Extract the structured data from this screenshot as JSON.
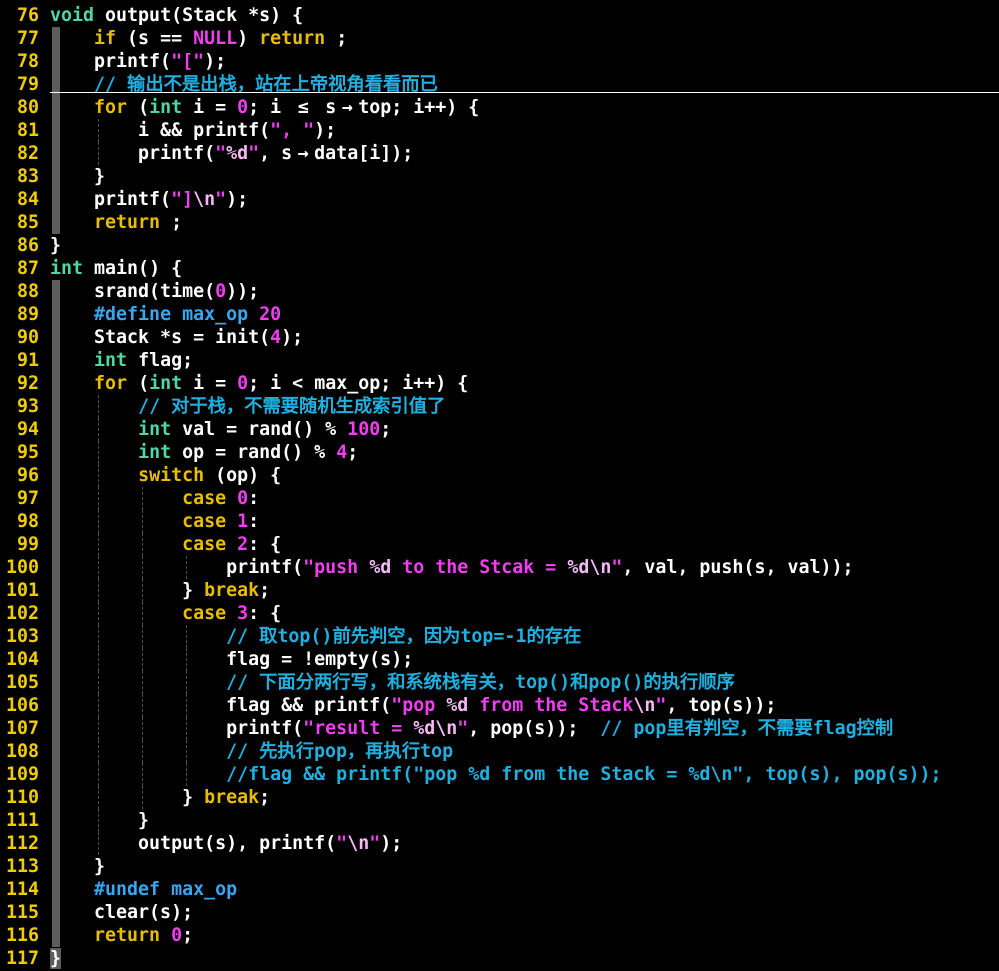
{
  "colors": {
    "background": "#000000",
    "text": "#ffffff",
    "line_number": "#efcc00",
    "keyword": "#e8bd00",
    "type": "#4fd6a8",
    "string": "#f03ef0",
    "escape": "#f4b8f4",
    "number": "#f03ef0",
    "comment": "#1fb0e0",
    "preprocessor": "#38a6f0",
    "indent_bar": "#5c5c5c",
    "indent_guide": "#4d4d4d",
    "cursor_line": "#ffffff"
  },
  "cursor_line": "79",
  "lines": [
    {
      "n": "76",
      "code": [
        [
          "ty",
          "void"
        ],
        [
          "pl",
          " output(Stack *s) {"
        ]
      ]
    },
    {
      "n": "77",
      "code": [
        [
          "pl",
          "    "
        ],
        [
          "kw",
          "if"
        ],
        [
          "pl",
          " (s == "
        ],
        [
          "const",
          "NULL"
        ],
        [
          "pl",
          ") "
        ],
        [
          "kw",
          "return"
        ],
        [
          "pl",
          " ;"
        ]
      ]
    },
    {
      "n": "78",
      "code": [
        [
          "pl",
          "    printf("
        ],
        [
          "str",
          "\"[\""
        ],
        [
          "pl",
          ");"
        ]
      ]
    },
    {
      "n": "79",
      "code": [
        [
          "pl",
          "    "
        ],
        [
          "cm",
          "// 输出不是出栈，站在上帝视角看看而已"
        ]
      ]
    },
    {
      "n": "80",
      "code": [
        [
          "pl",
          "    "
        ],
        [
          "kw",
          "for"
        ],
        [
          "pl",
          " ("
        ],
        [
          "ty",
          "int"
        ],
        [
          "pl",
          " i = "
        ],
        [
          "num",
          "0"
        ],
        [
          "pl",
          "; i "
        ],
        [
          "lig",
          "≤"
        ],
        [
          "pl",
          " s"
        ],
        [
          "lig",
          "→"
        ],
        [
          "pl",
          "top; i++) {"
        ]
      ]
    },
    {
      "n": "81",
      "code": [
        [
          "pl",
          "        i && printf("
        ],
        [
          "str",
          "\", \""
        ],
        [
          "pl",
          ");"
        ]
      ]
    },
    {
      "n": "82",
      "code": [
        [
          "pl",
          "        printf("
        ],
        [
          "str",
          "\""
        ],
        [
          "esc",
          "%d"
        ],
        [
          "str",
          "\""
        ],
        [
          "pl",
          ", s"
        ],
        [
          "lig",
          "→"
        ],
        [
          "pl",
          "data[i]);"
        ]
      ]
    },
    {
      "n": "83",
      "code": [
        [
          "pl",
          "    }"
        ]
      ]
    },
    {
      "n": "84",
      "code": [
        [
          "pl",
          "    printf("
        ],
        [
          "str",
          "\"]"
        ],
        [
          "esc",
          "\\n"
        ],
        [
          "str",
          "\""
        ],
        [
          "pl",
          ");"
        ]
      ]
    },
    {
      "n": "85",
      "code": [
        [
          "pl",
          "    "
        ],
        [
          "kw",
          "return"
        ],
        [
          "pl",
          " ;"
        ]
      ]
    },
    {
      "n": "86",
      "code": [
        [
          "pl",
          "}"
        ]
      ]
    },
    {
      "n": "87",
      "code": [
        [
          "ty",
          "int"
        ],
        [
          "pl",
          " main() {"
        ]
      ]
    },
    {
      "n": "88",
      "code": [
        [
          "pl",
          "    srand(time("
        ],
        [
          "num",
          "0"
        ],
        [
          "pl",
          "));"
        ]
      ]
    },
    {
      "n": "89",
      "code": [
        [
          "pl",
          "    "
        ],
        [
          "pp",
          "#define"
        ],
        [
          "pl",
          " "
        ],
        [
          "pp",
          "max_op"
        ],
        [
          "pl",
          " "
        ],
        [
          "num",
          "20"
        ]
      ]
    },
    {
      "n": "90",
      "code": [
        [
          "pl",
          "    Stack *s = init("
        ],
        [
          "num",
          "4"
        ],
        [
          "pl",
          ");"
        ]
      ]
    },
    {
      "n": "91",
      "code": [
        [
          "pl",
          "    "
        ],
        [
          "ty",
          "int"
        ],
        [
          "pl",
          " flag;"
        ]
      ]
    },
    {
      "n": "92",
      "code": [
        [
          "pl",
          "    "
        ],
        [
          "kw",
          "for"
        ],
        [
          "pl",
          " ("
        ],
        [
          "ty",
          "int"
        ],
        [
          "pl",
          " i = "
        ],
        [
          "num",
          "0"
        ],
        [
          "pl",
          "; i < max_op; i++) {"
        ]
      ]
    },
    {
      "n": "93",
      "code": [
        [
          "pl",
          "        "
        ],
        [
          "cm",
          "// 对于栈，不需要随机生成索引值了"
        ]
      ]
    },
    {
      "n": "94",
      "code": [
        [
          "pl",
          "        "
        ],
        [
          "ty",
          "int"
        ],
        [
          "pl",
          " val = rand() % "
        ],
        [
          "num",
          "100"
        ],
        [
          "pl",
          ";"
        ]
      ]
    },
    {
      "n": "95",
      "code": [
        [
          "pl",
          "        "
        ],
        [
          "ty",
          "int"
        ],
        [
          "pl",
          " op = rand() % "
        ],
        [
          "num",
          "4"
        ],
        [
          "pl",
          ";"
        ]
      ]
    },
    {
      "n": "96",
      "code": [
        [
          "pl",
          "        "
        ],
        [
          "kw",
          "switch"
        ],
        [
          "pl",
          " (op) {"
        ]
      ]
    },
    {
      "n": "97",
      "code": [
        [
          "pl",
          "            "
        ],
        [
          "kw",
          "case"
        ],
        [
          "pl",
          " "
        ],
        [
          "num",
          "0"
        ],
        [
          "pl",
          ":"
        ]
      ]
    },
    {
      "n": "98",
      "code": [
        [
          "pl",
          "            "
        ],
        [
          "kw",
          "case"
        ],
        [
          "pl",
          " "
        ],
        [
          "num",
          "1"
        ],
        [
          "pl",
          ":"
        ]
      ]
    },
    {
      "n": "99",
      "code": [
        [
          "pl",
          "            "
        ],
        [
          "kw",
          "case"
        ],
        [
          "pl",
          " "
        ],
        [
          "num",
          "2"
        ],
        [
          "pl",
          ": {"
        ]
      ]
    },
    {
      "n": "100",
      "code": [
        [
          "pl",
          "                printf("
        ],
        [
          "str",
          "\"push "
        ],
        [
          "esc",
          "%d"
        ],
        [
          "str",
          " to the Stcak = "
        ],
        [
          "esc",
          "%d\\n"
        ],
        [
          "str",
          "\""
        ],
        [
          "pl",
          ", val, push(s, val));"
        ]
      ]
    },
    {
      "n": "101",
      "code": [
        [
          "pl",
          "            } "
        ],
        [
          "kw",
          "break"
        ],
        [
          "pl",
          ";"
        ]
      ]
    },
    {
      "n": "102",
      "code": [
        [
          "pl",
          "            "
        ],
        [
          "kw",
          "case"
        ],
        [
          "pl",
          " "
        ],
        [
          "num",
          "3"
        ],
        [
          "pl",
          ": {"
        ]
      ]
    },
    {
      "n": "103",
      "code": [
        [
          "pl",
          "                "
        ],
        [
          "cm",
          "// 取top()前先判空，因为top=-1的存在"
        ]
      ]
    },
    {
      "n": "104",
      "code": [
        [
          "pl",
          "                flag = !empty(s);"
        ]
      ]
    },
    {
      "n": "105",
      "code": [
        [
          "pl",
          "                "
        ],
        [
          "cm",
          "// 下面分两行写，和系统栈有关，top()和pop()的执行顺序"
        ]
      ]
    },
    {
      "n": "106",
      "code": [
        [
          "pl",
          "                flag && printf("
        ],
        [
          "str",
          "\"pop "
        ],
        [
          "esc",
          "%d"
        ],
        [
          "str",
          " from the Stack"
        ],
        [
          "esc",
          "\\n"
        ],
        [
          "str",
          "\""
        ],
        [
          "pl",
          ", top(s));"
        ]
      ]
    },
    {
      "n": "107",
      "code": [
        [
          "pl",
          "                printf("
        ],
        [
          "str",
          "\"result = "
        ],
        [
          "esc",
          "%d\\n"
        ],
        [
          "str",
          "\""
        ],
        [
          "pl",
          ", pop(s));  "
        ],
        [
          "cm",
          "// pop里有判空，不需要flag控制"
        ]
      ]
    },
    {
      "n": "108",
      "code": [
        [
          "pl",
          "                "
        ],
        [
          "cm",
          "// 先执行pop，再执行top"
        ]
      ]
    },
    {
      "n": "109",
      "code": [
        [
          "pl",
          "                "
        ],
        [
          "cm",
          "//flag && printf(\"pop %d from the Stack = %d\\n\", top(s), pop(s));"
        ]
      ]
    },
    {
      "n": "110",
      "code": [
        [
          "pl",
          "            } "
        ],
        [
          "kw",
          "break"
        ],
        [
          "pl",
          ";"
        ]
      ]
    },
    {
      "n": "111",
      "code": [
        [
          "pl",
          "        }"
        ]
      ]
    },
    {
      "n": "112",
      "code": [
        [
          "pl",
          "        output(s), printf("
        ],
        [
          "str",
          "\""
        ],
        [
          "esc",
          "\\n"
        ],
        [
          "str",
          "\""
        ],
        [
          "pl",
          ");"
        ]
      ]
    },
    {
      "n": "113",
      "code": [
        [
          "pl",
          "    }"
        ]
      ]
    },
    {
      "n": "114",
      "code": [
        [
          "pl",
          "    "
        ],
        [
          "pp",
          "#undef"
        ],
        [
          "pl",
          " "
        ],
        [
          "pp",
          "max_op"
        ]
      ]
    },
    {
      "n": "115",
      "code": [
        [
          "pl",
          "    clear(s);"
        ]
      ]
    },
    {
      "n": "116",
      "code": [
        [
          "pl",
          "    "
        ],
        [
          "kw",
          "return"
        ],
        [
          "pl",
          " "
        ],
        [
          "num",
          "0"
        ],
        [
          "pl",
          ";"
        ]
      ]
    },
    {
      "n": "117",
      "code": [
        [
          "hl",
          "}"
        ]
      ]
    }
  ]
}
